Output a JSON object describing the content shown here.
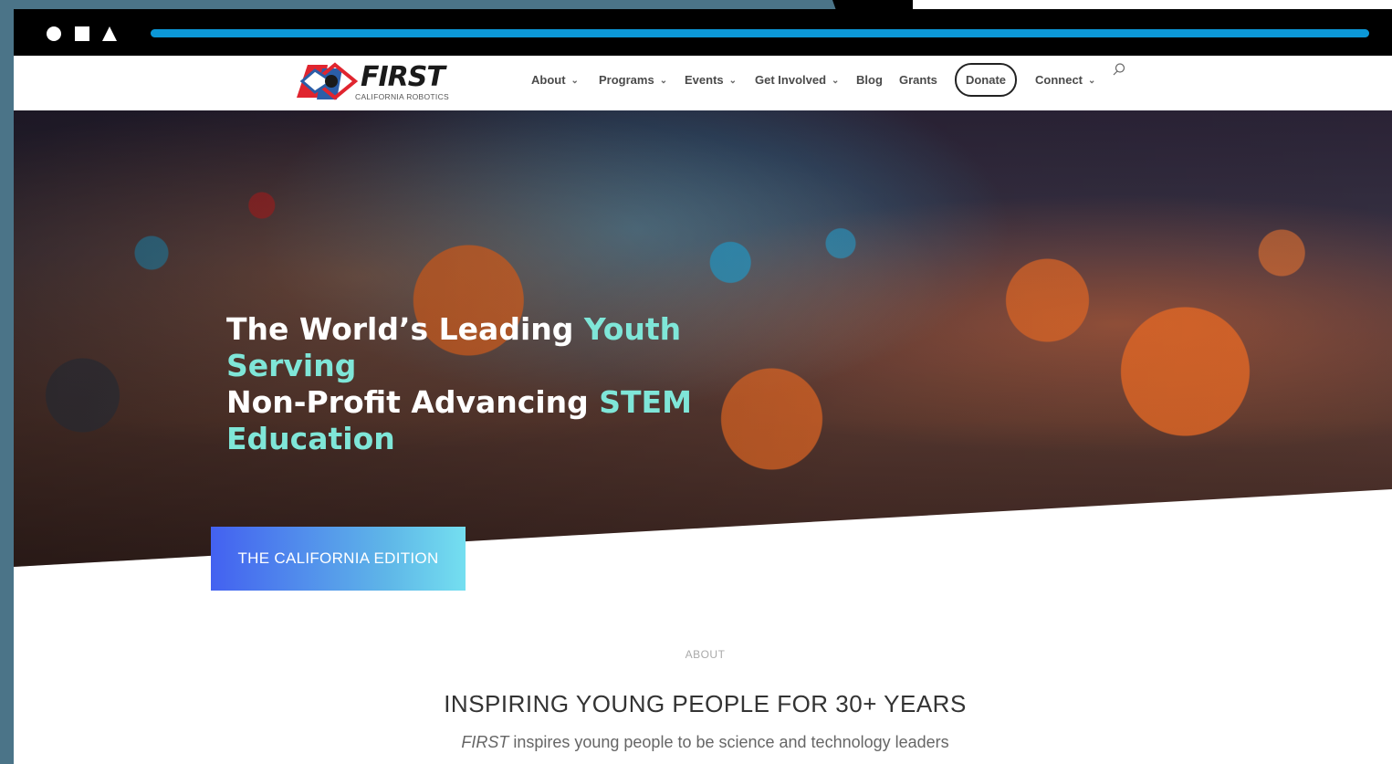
{
  "window": {
    "controls": [
      "circle",
      "square",
      "triangle"
    ],
    "progress_pct": 100
  },
  "logo": {
    "word": "FIRST",
    "sub": "CALIFORNIA ROBOTICS"
  },
  "nav": {
    "items": [
      {
        "label": "About",
        "dropdown": true
      },
      {
        "label": "Programs",
        "dropdown": true
      },
      {
        "label": "Events",
        "dropdown": true
      },
      {
        "label": "Get Involved",
        "dropdown": true
      },
      {
        "label": "Blog",
        "dropdown": false
      },
      {
        "label": "Grants",
        "dropdown": false
      },
      {
        "label": "Connect",
        "dropdown": true
      }
    ],
    "donate": "Donate",
    "search_icon": "search-icon"
  },
  "hero": {
    "line1_a": "The World’s Leading ",
    "line1_b": "Youth Serving",
    "line2_a": "Non-Profit Advancing ",
    "line2_b": "STEM",
    "line3": "Education",
    "cta": "THE CALIFORNIA EDITION"
  },
  "about": {
    "label": "ABOUT",
    "title": "INSPIRING YOUNG PEOPLE FOR 30+ YEARS",
    "body_italic": "FIRST",
    "body_rest": " inspires young people to be science and technology leaders"
  },
  "colors": {
    "accent": "#7fe6d8",
    "progress": "#0c98d8",
    "cta_start": "#4361f0",
    "cta_end": "#74dff0"
  }
}
